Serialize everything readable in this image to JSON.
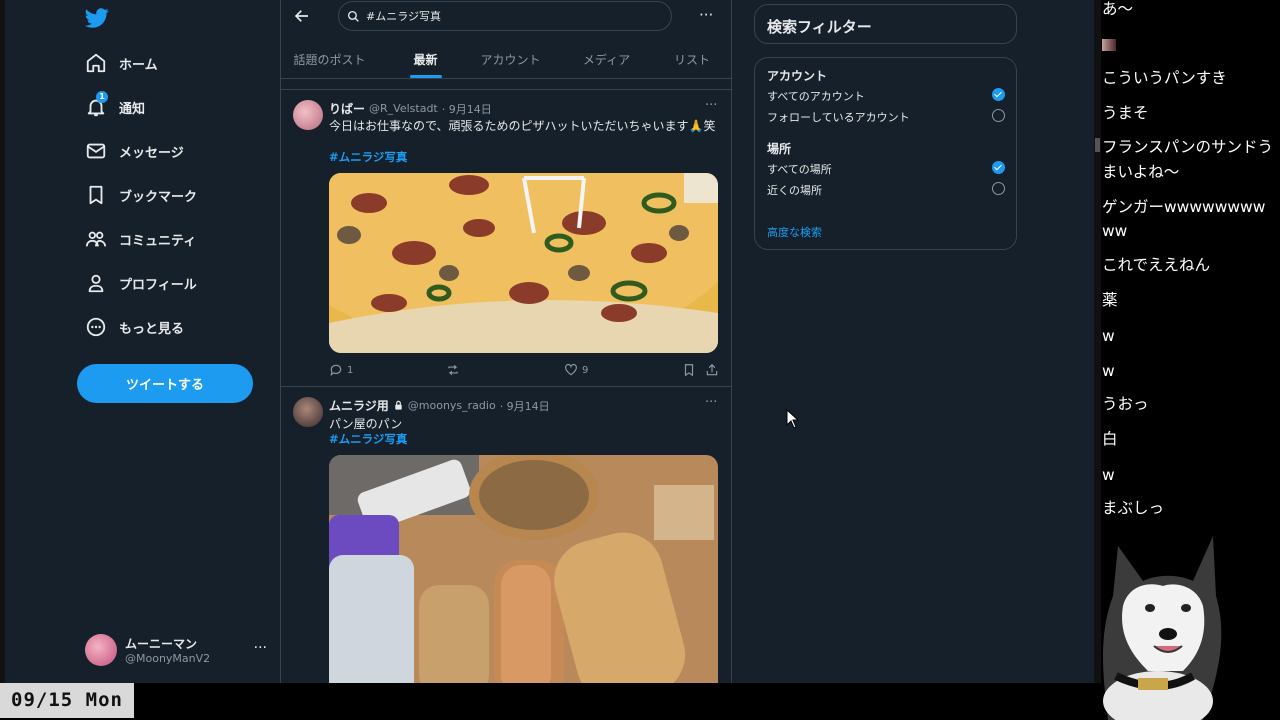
{
  "sidebar": {
    "nav": [
      {
        "label": "ホーム",
        "icon": "home-icon"
      },
      {
        "label": "通知",
        "icon": "bell-icon",
        "badge": "1"
      },
      {
        "label": "メッセージ",
        "icon": "mail-icon"
      },
      {
        "label": "ブックマーク",
        "icon": "bookmark-icon"
      },
      {
        "label": "コミュニティ",
        "icon": "community-icon"
      },
      {
        "label": "プロフィール",
        "icon": "profile-icon"
      },
      {
        "label": "もっと見る",
        "icon": "more-circle-icon"
      }
    ],
    "tweet_button": "ツイートする",
    "account": {
      "display_name": "ムーニーマン",
      "handle": "@MoonyManV2",
      "more": "···"
    }
  },
  "main": {
    "search": {
      "value": "#ムニラジ写真"
    },
    "more": "···",
    "tabs": [
      {
        "label": "話題のポスト",
        "active": false
      },
      {
        "label": "最新",
        "active": true
      },
      {
        "label": "アカウント",
        "active": false
      },
      {
        "label": "メディア",
        "active": false
      },
      {
        "label": "リスト",
        "active": false
      }
    ],
    "tweets": [
      {
        "name": "りばー",
        "handle": "@R_Velstadt",
        "date": "· 9月14日",
        "text": "今日はお仕事なので、頑張るためのピザハットいただいちゃいます🙏笑",
        "hashtag": "#ムニラジ写真",
        "replies": "1",
        "likes": "9",
        "more": "···"
      },
      {
        "name": "ムニラジ用",
        "handle": "@moonys_radio",
        "date": "· 9月14日",
        "text": "パン屋のパン",
        "hashtag": "#ムニラジ写真",
        "more": "···"
      }
    ]
  },
  "filters": {
    "title": "検索フィルター",
    "account_heading": "アカウント",
    "account_options": [
      {
        "label": "すべてのアカウント",
        "checked": true
      },
      {
        "label": "フォローしているアカウント",
        "checked": false
      }
    ],
    "place_heading": "場所",
    "place_options": [
      {
        "label": "すべての場所",
        "checked": true
      },
      {
        "label": "近くの場所",
        "checked": false
      }
    ],
    "advanced": "高度な検索"
  },
  "comments": [
    "あ〜",
    "こういうパンすき",
    "うまそ",
    "フランスパンのサンドう",
    "まいよね〜",
    "ゲンガーwwwwwwww",
    "ww",
    "これでええねん",
    "薬",
    "w",
    "w",
    "うおっ",
    "白",
    "w",
    "まぶしっ"
  ],
  "date_badge": "09/15 Mon",
  "colors": {
    "accent": "#1d9bf0",
    "background": "#15202b",
    "border": "#38444d",
    "muted": "#8b98a5"
  }
}
